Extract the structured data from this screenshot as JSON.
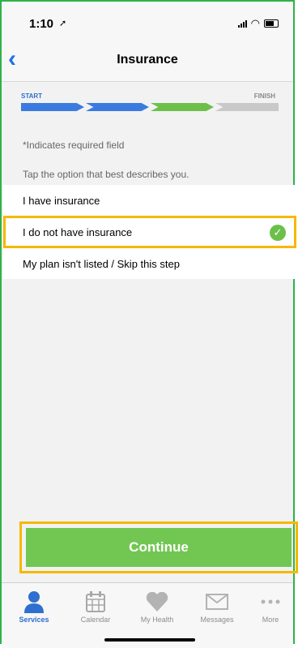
{
  "status_bar": {
    "time": "1:10",
    "location_icon": "arrow-icon",
    "signal_icon": "signal-icon",
    "wifi_icon": "wifi-icon",
    "battery_icon": "battery-icon"
  },
  "nav": {
    "back_icon": "chevron-left-icon",
    "title": "Insurance"
  },
  "progress": {
    "start_label": "START",
    "finish_label": "FINISH",
    "completed_fraction": 0.75,
    "colors": {
      "done": "#3b7be0",
      "current": "#6cc04a",
      "remaining": "#c9c9c9"
    }
  },
  "required_note": "*Indicates required field",
  "instruction": "Tap the option that best describes you.",
  "options": [
    {
      "label": "I have insurance",
      "selected": false
    },
    {
      "label": "I do not have insurance",
      "selected": true
    },
    {
      "label": "My plan isn't listed / Skip this step",
      "selected": false
    }
  ],
  "continue_label": "Continue",
  "tabs": [
    {
      "label": "Services",
      "icon": "person-icon",
      "active": true
    },
    {
      "label": "Calendar",
      "icon": "calendar-icon",
      "active": false
    },
    {
      "label": "My Health",
      "icon": "heart-icon",
      "active": false
    },
    {
      "label": "Messages",
      "icon": "envelope-icon",
      "active": false
    },
    {
      "label": "More",
      "icon": "more-dots-icon",
      "active": false
    }
  ],
  "colors": {
    "accent": "#2f6fcf",
    "highlight": "#f5b800",
    "button": "#72c753",
    "border": "#2db24a"
  }
}
